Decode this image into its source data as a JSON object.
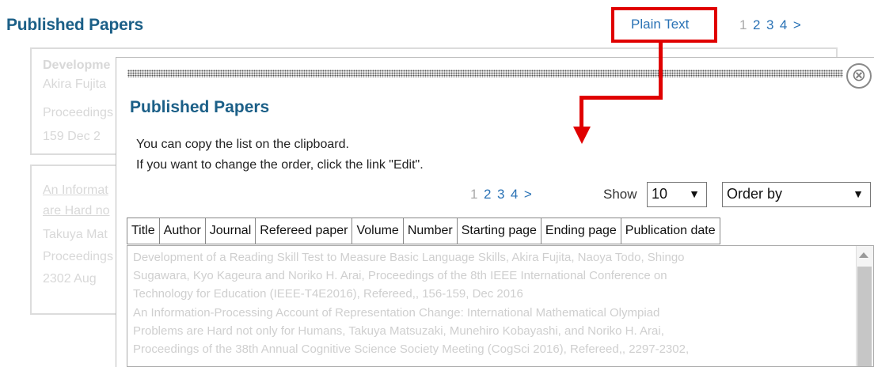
{
  "background": {
    "title": "Published Papers",
    "plain_text_link": "Plain Text",
    "pager": [
      "1",
      "2",
      "3",
      "4",
      ">"
    ],
    "cards": [
      {
        "lines": [
          "Developme",
          "Akira Fujita",
          "Proceedings",
          "159   Dec 2"
        ]
      },
      {
        "lines": [
          "An Informat",
          "are Hard no",
          "Takuya Mat",
          "Proceedings",
          "2302   Aug"
        ]
      }
    ]
  },
  "dialog": {
    "close_symbol": "⊗",
    "title": "Published Papers",
    "instruction_1": "You can copy the list on the clipboard.",
    "instruction_2": "If you want to change the order, click the link \"Edit\".",
    "pager": [
      "1",
      "2",
      "3",
      "4",
      ">"
    ],
    "show_label": "Show",
    "show_value": "10",
    "order_placeholder": "Order by",
    "dropdown_arrow": "▼",
    "columns": [
      "Title",
      "Author",
      "Journal",
      "Refereed paper",
      "Volume",
      "Number",
      "Starting page",
      "Ending page",
      "Publication date"
    ],
    "text_lines": [
      "Development of a Reading Skill Test to Measure Basic Language Skills, Akira Fujita, Naoya Todo, Shingo",
      "Sugawara, Kyo Kageura and Noriko H. Arai, Proceedings of the 8th IEEE International Conference on",
      "Technology for Education (IEEE-T4E2016), Refereed,, 156-159, Dec 2016",
      "An Information-Processing Account of Representation Change: International Mathematical Olympiad",
      "Problems are Hard not only for Humans, Takuya Matsuzaki, Munehiro Kobayashi, and Noriko H. Arai,",
      "Proceedings of the 38th Annual Cognitive Science Society Meeting (CogSci 2016), Refereed,, 2297-2302,"
    ]
  },
  "colors": {
    "heading": "#1b5f87",
    "link": "#2a72b5",
    "annotation_red": "#e00000",
    "faded_text": "#d0d0d0"
  }
}
